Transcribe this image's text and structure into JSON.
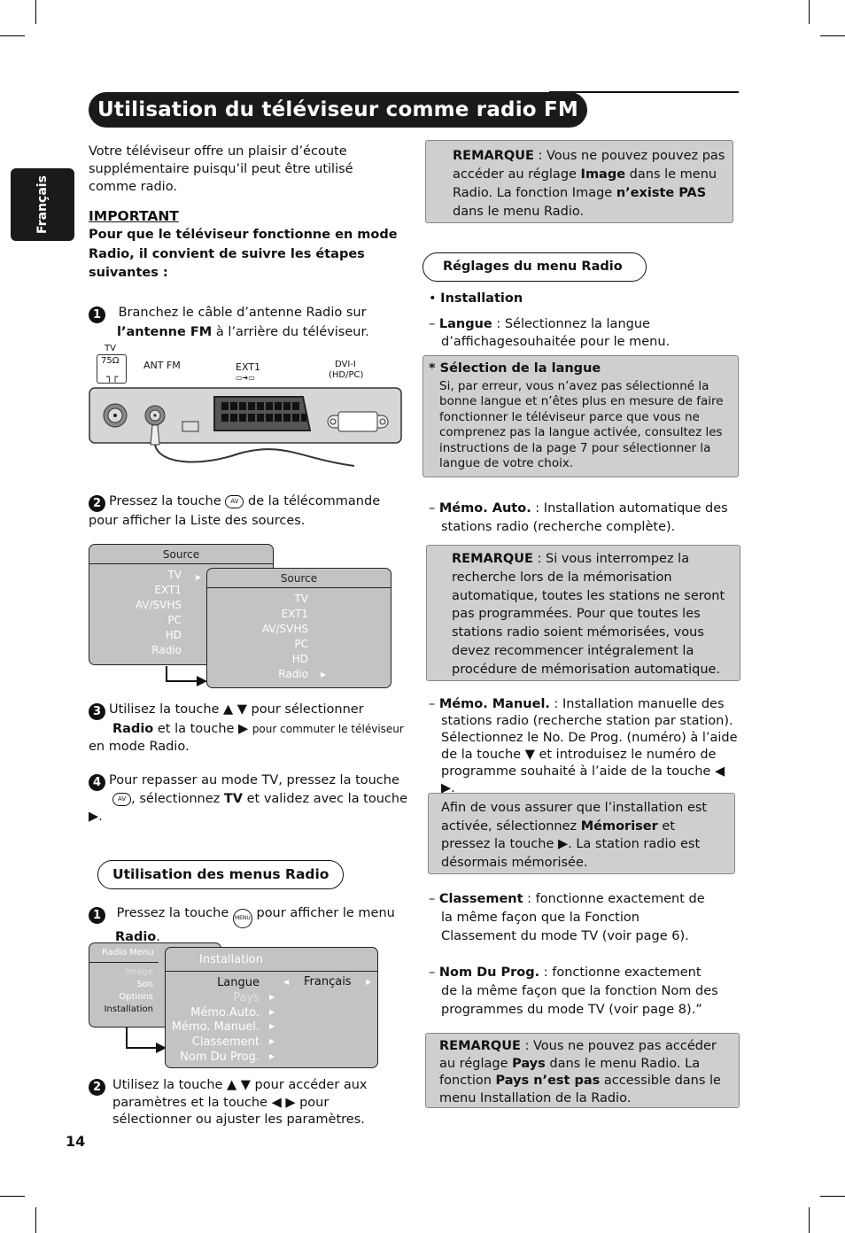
{
  "page": {
    "title": "Utilisation du téléviseur comme radio FM",
    "language_tab": "Français",
    "page_number": "14"
  },
  "left": {
    "intro": "Votre téléviseur offre un plaisir d’écoute supplémentaire puisqu’il peut être utilisé comme radio.",
    "important_heading": "IMPORTANT",
    "important_text": "Pour que le téléviseur fonctionne en mode Radio, il convient de suivre les étapes suivantes :",
    "step1": {
      "num": "1",
      "text_a": "Branchez le câble d’antenne Radio sur",
      "text_bold": "l’antenne FM",
      "text_b": " à l’arrière du téléviseur."
    },
    "diagram": {
      "tv_label": "TV",
      "ohm_label": "75Ω",
      "ant_fm_label": "ANT FM",
      "ext1_label": "EXT1",
      "dvi_label": "DVI-I",
      "dvi_sub": "(HD/PC)"
    },
    "step2": {
      "num": "2",
      "text_a": "Pressez la touche",
      "key": "AV",
      "text_b": "de la télécommande pour afficher la Liste des sources."
    },
    "source_menu_1": {
      "title": "Source",
      "items": [
        "TV",
        "EXT1",
        "AV/SVHS",
        "PC",
        "HD",
        "Radio"
      ]
    },
    "source_menu_2": {
      "title": "Source",
      "items": [
        "TV",
        "EXT1",
        "AV/SVHS",
        "PC",
        "HD",
        "Radio"
      ]
    },
    "step3": {
      "num": "3",
      "text_a": "Utilisez la touche ▲ ▼ pour sélectionner",
      "bold": "Radio",
      "text_b": " et la touche ▶ ",
      "small": "pour commuter le téléviseur",
      "text_c": " en mode Radio."
    },
    "step4": {
      "num": "4",
      "text_a": "Pour repasser au mode TV, pressez la touche",
      "key": "AV",
      "text_b": ", sélectionnez ",
      "bold": "TV",
      "text_c": " et validez avec la touche ▶."
    },
    "section2_title": "Utilisation des menus Radio",
    "step5": {
      "num": "1",
      "text_a": "Pressez la touche",
      "key": "MENU",
      "text_b": " pour afficher le menu ",
      "bold": "Radio",
      "text_c": "."
    },
    "radio_menu": {
      "title": "Radio Menu",
      "items": [
        {
          "label": "Image",
          "disabled": true
        },
        {
          "label": "Son"
        },
        {
          "label": "Options"
        },
        {
          "label": "Installation",
          "active": true
        }
      ]
    },
    "install_menu": {
      "title": "Installation",
      "items": [
        {
          "label": "Langue",
          "value": "Français",
          "active": true
        },
        {
          "label": "Pays",
          "disabled": true
        },
        {
          "label": "Mémo.Auto."
        },
        {
          "label": "Mémo. Manuel."
        },
        {
          "label": "Classement"
        },
        {
          "label": "Nom Du Prog."
        }
      ]
    },
    "step6": {
      "num": "2",
      "text": "Utilisez la touche ▲ ▼ pour accéder aux paramètres et la touche ◀ ▶ pour sélectionner ou ajuster les paramètres."
    }
  },
  "right": {
    "note1": {
      "label": "REMARQUE",
      "a": " : Vous ne pouvez pouvez pas accéder au réglage ",
      "b1": "Image",
      "c": " dans le menu Radio. La fonction Image ",
      "b2": "n’existe PAS",
      "d": " dans le menu Radio."
    },
    "section_title": "Réglages du menu Radio",
    "installation_bullet": "Installation",
    "langue": {
      "label": "Langue",
      "text": " : Sélectionnez la langue d’affichagesouhaitée pour le menu."
    },
    "lang_select_box": {
      "title": "* Sélection de la langue",
      "text": "Si, par erreur, vous n’avez pas sélectionné la bonne langue et n’êtes plus en mesure de faire fonctionner le téléviseur parce que vous ne comprenez pas la langue activée, consultez les instructions de la page 7 pour sélectionner la langue de votre choix."
    },
    "memo_auto": {
      "label": "Mémo. Auto.",
      "text": " : Installation automatique des stations radio (recherche complète)."
    },
    "note2": {
      "label": "REMARQUE",
      "text": " : Si vous interrompez la recherche lors de la mémorisation automatique, toutes les stations ne seront pas programmées. Pour que toutes les stations radio soient mémorisées, vous devez recommencer intégralement la procédure de mémorisation automatique."
    },
    "memo_manuel": {
      "label": "Mémo. Manuel.",
      "text": " : Installation manuelle des stations radio (recherche station par station). Sélectionnez le No. De Prog. (numéro) à l’aide de la touche ▼ et introduisez le numéro de programme souhaité à l’aide de la touche ◀ ▶."
    },
    "memoriser_box": {
      "a": "Afin de vous assurer que l’installation est activée, sélectionnez ",
      "bold": "Mémoriser",
      "b": " et pressez la touche ▶. La station radio est désormais mémorisée."
    },
    "classement": {
      "label": "Classement",
      "text": " : fonctionne exactement de la même façon que la Fonction Classement du mode TV (voir page 6)."
    },
    "nom_prog": {
      "label": "Nom Du Prog.",
      "text": " : fonctionne exactement de la même façon que la fonction Nom des programmes du mode TV (voir page 8).”"
    },
    "note3": {
      "label": "REMARQUE",
      "a": " : Vous ne pouvez pas accéder au réglage ",
      "b1": "Pays",
      "c": " dans le menu Radio. La fonction ",
      "b2": "Pays n’est pas",
      "d": " accessible dans le menu Installation de la Radio."
    }
  }
}
